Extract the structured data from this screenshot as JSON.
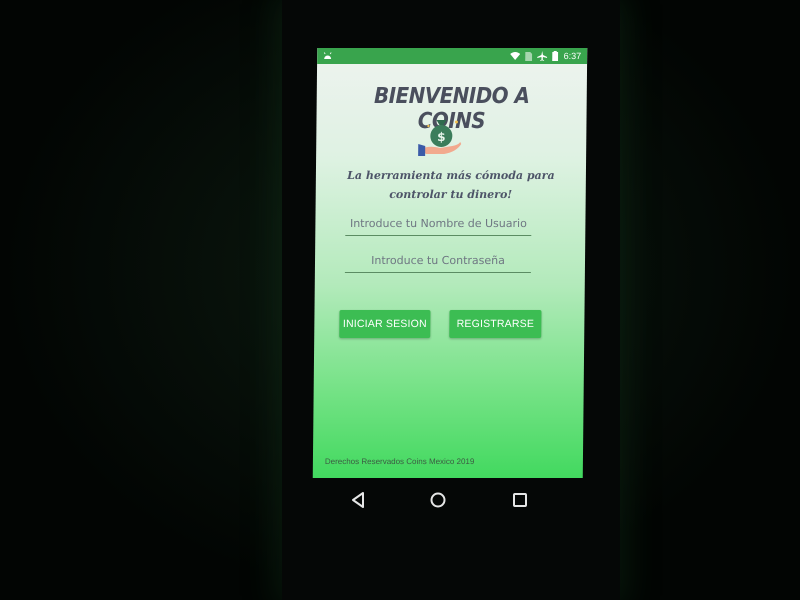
{
  "status_bar": {
    "time": "6:37",
    "icons": [
      "android-debug-icon",
      "wifi-icon",
      "no-sim-icon",
      "airplane-mode-icon",
      "battery-icon"
    ]
  },
  "app": {
    "title": "BIENVENIDO A COINS",
    "logo_icon": "money-bag-hand-icon",
    "tagline": "La herramienta más cómoda para controlar tu dinero!",
    "username_field": {
      "placeholder": "Introduce tu Nombre de Usuario",
      "value": ""
    },
    "password_field": {
      "placeholder": "Introduce tu Contraseña",
      "value": ""
    },
    "login_button": "INICIAR SESION",
    "register_button": "REGISTRARSE",
    "footer": "Derechos Reservados Coins Mexico 2019"
  },
  "colors": {
    "status_bar": "#39a44d",
    "button": "#3cbd53",
    "title": "#4a4f5d",
    "screen_bottom": "#42d95f"
  },
  "nav_bar": {
    "icons": [
      "back-triangle-icon",
      "home-circle-icon",
      "recents-square-icon"
    ]
  }
}
